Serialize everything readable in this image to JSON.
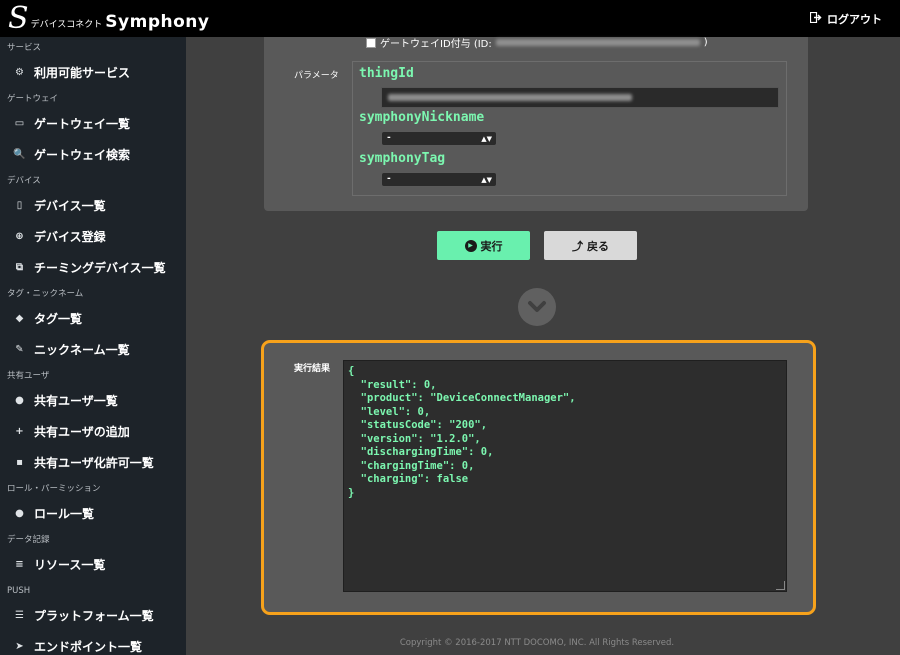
{
  "header": {
    "logo_sub": "デバイスコネクト",
    "logo_main": "Symphony",
    "logout_label": "ログアウト"
  },
  "sidebar": {
    "sections": [
      {
        "title": "サービス",
        "items": [
          {
            "label": "利用可能サービス",
            "icon": "gears-icon"
          }
        ]
      },
      {
        "title": "ゲートウェイ",
        "items": [
          {
            "label": "ゲートウェイ一覧",
            "icon": "hdd-icon"
          },
          {
            "label": "ゲートウェイ検索",
            "icon": "search-icon"
          }
        ]
      },
      {
        "title": "デバイス",
        "items": [
          {
            "label": "デバイス一覧",
            "icon": "mobile-icon"
          },
          {
            "label": "デバイス登録",
            "icon": "plus-circle-icon"
          },
          {
            "label": "チーミングデバイス一覧",
            "icon": "clone-icon"
          }
        ]
      },
      {
        "title": "タグ・ニックネーム",
        "items": [
          {
            "label": "タグ一覧",
            "icon": "tags-icon"
          },
          {
            "label": "ニックネーム一覧",
            "icon": "pencil-icon"
          }
        ]
      },
      {
        "title": "共有ユーザ",
        "items": [
          {
            "label": "共有ユーザ一覧",
            "icon": "user-icon"
          },
          {
            "label": "共有ユーザの追加",
            "icon": "user-plus-icon"
          },
          {
            "label": "共有ユーザ化許可一覧",
            "icon": "unlock-icon"
          }
        ]
      },
      {
        "title": "ロール・パーミッション",
        "items": [
          {
            "label": "ロール一覧",
            "icon": "users-icon"
          }
        ]
      },
      {
        "title": "データ記録",
        "items": [
          {
            "label": "リソース一覧",
            "icon": "database-icon"
          }
        ]
      },
      {
        "title": "PUSH",
        "items": [
          {
            "label": "プラットフォーム一覧",
            "icon": "server-icon"
          },
          {
            "label": "エンドポイント一覧",
            "icon": "paper-plane-icon"
          }
        ]
      }
    ]
  },
  "form": {
    "gateway_checkbox_label": "ゲートウェイID付与 (ID:",
    "gateway_checkbox_suffix": ")",
    "params_label": "パラメータ",
    "params": {
      "thingId": {
        "name": "thingId"
      },
      "nickname": {
        "name": "symphonyNickname",
        "value": "-"
      },
      "tag": {
        "name": "symphonyTag",
        "value": "-"
      }
    },
    "run_label": "実行",
    "back_label": "戻る"
  },
  "result": {
    "label": "実行結果",
    "lines": [
      "{",
      "  \"result\": 0,",
      "  \"product\": \"DeviceConnectManager\",",
      "  \"level\": 0,",
      "  \"statusCode\": \"200\",",
      "  \"version\": \"1.2.0\",",
      "  \"dischargingTime\": 0,",
      "  \"chargingTime\": 0,",
      "  \"charging\": false",
      "}"
    ]
  },
  "footer": {
    "copyright": "Copyright © 2016-2017 NTT DOCOMO, INC. All Rights Reserved."
  },
  "colors": {
    "accent": "#69f0ae",
    "highlight": "#f7a21b",
    "sidebar_bg": "#1d2329"
  }
}
